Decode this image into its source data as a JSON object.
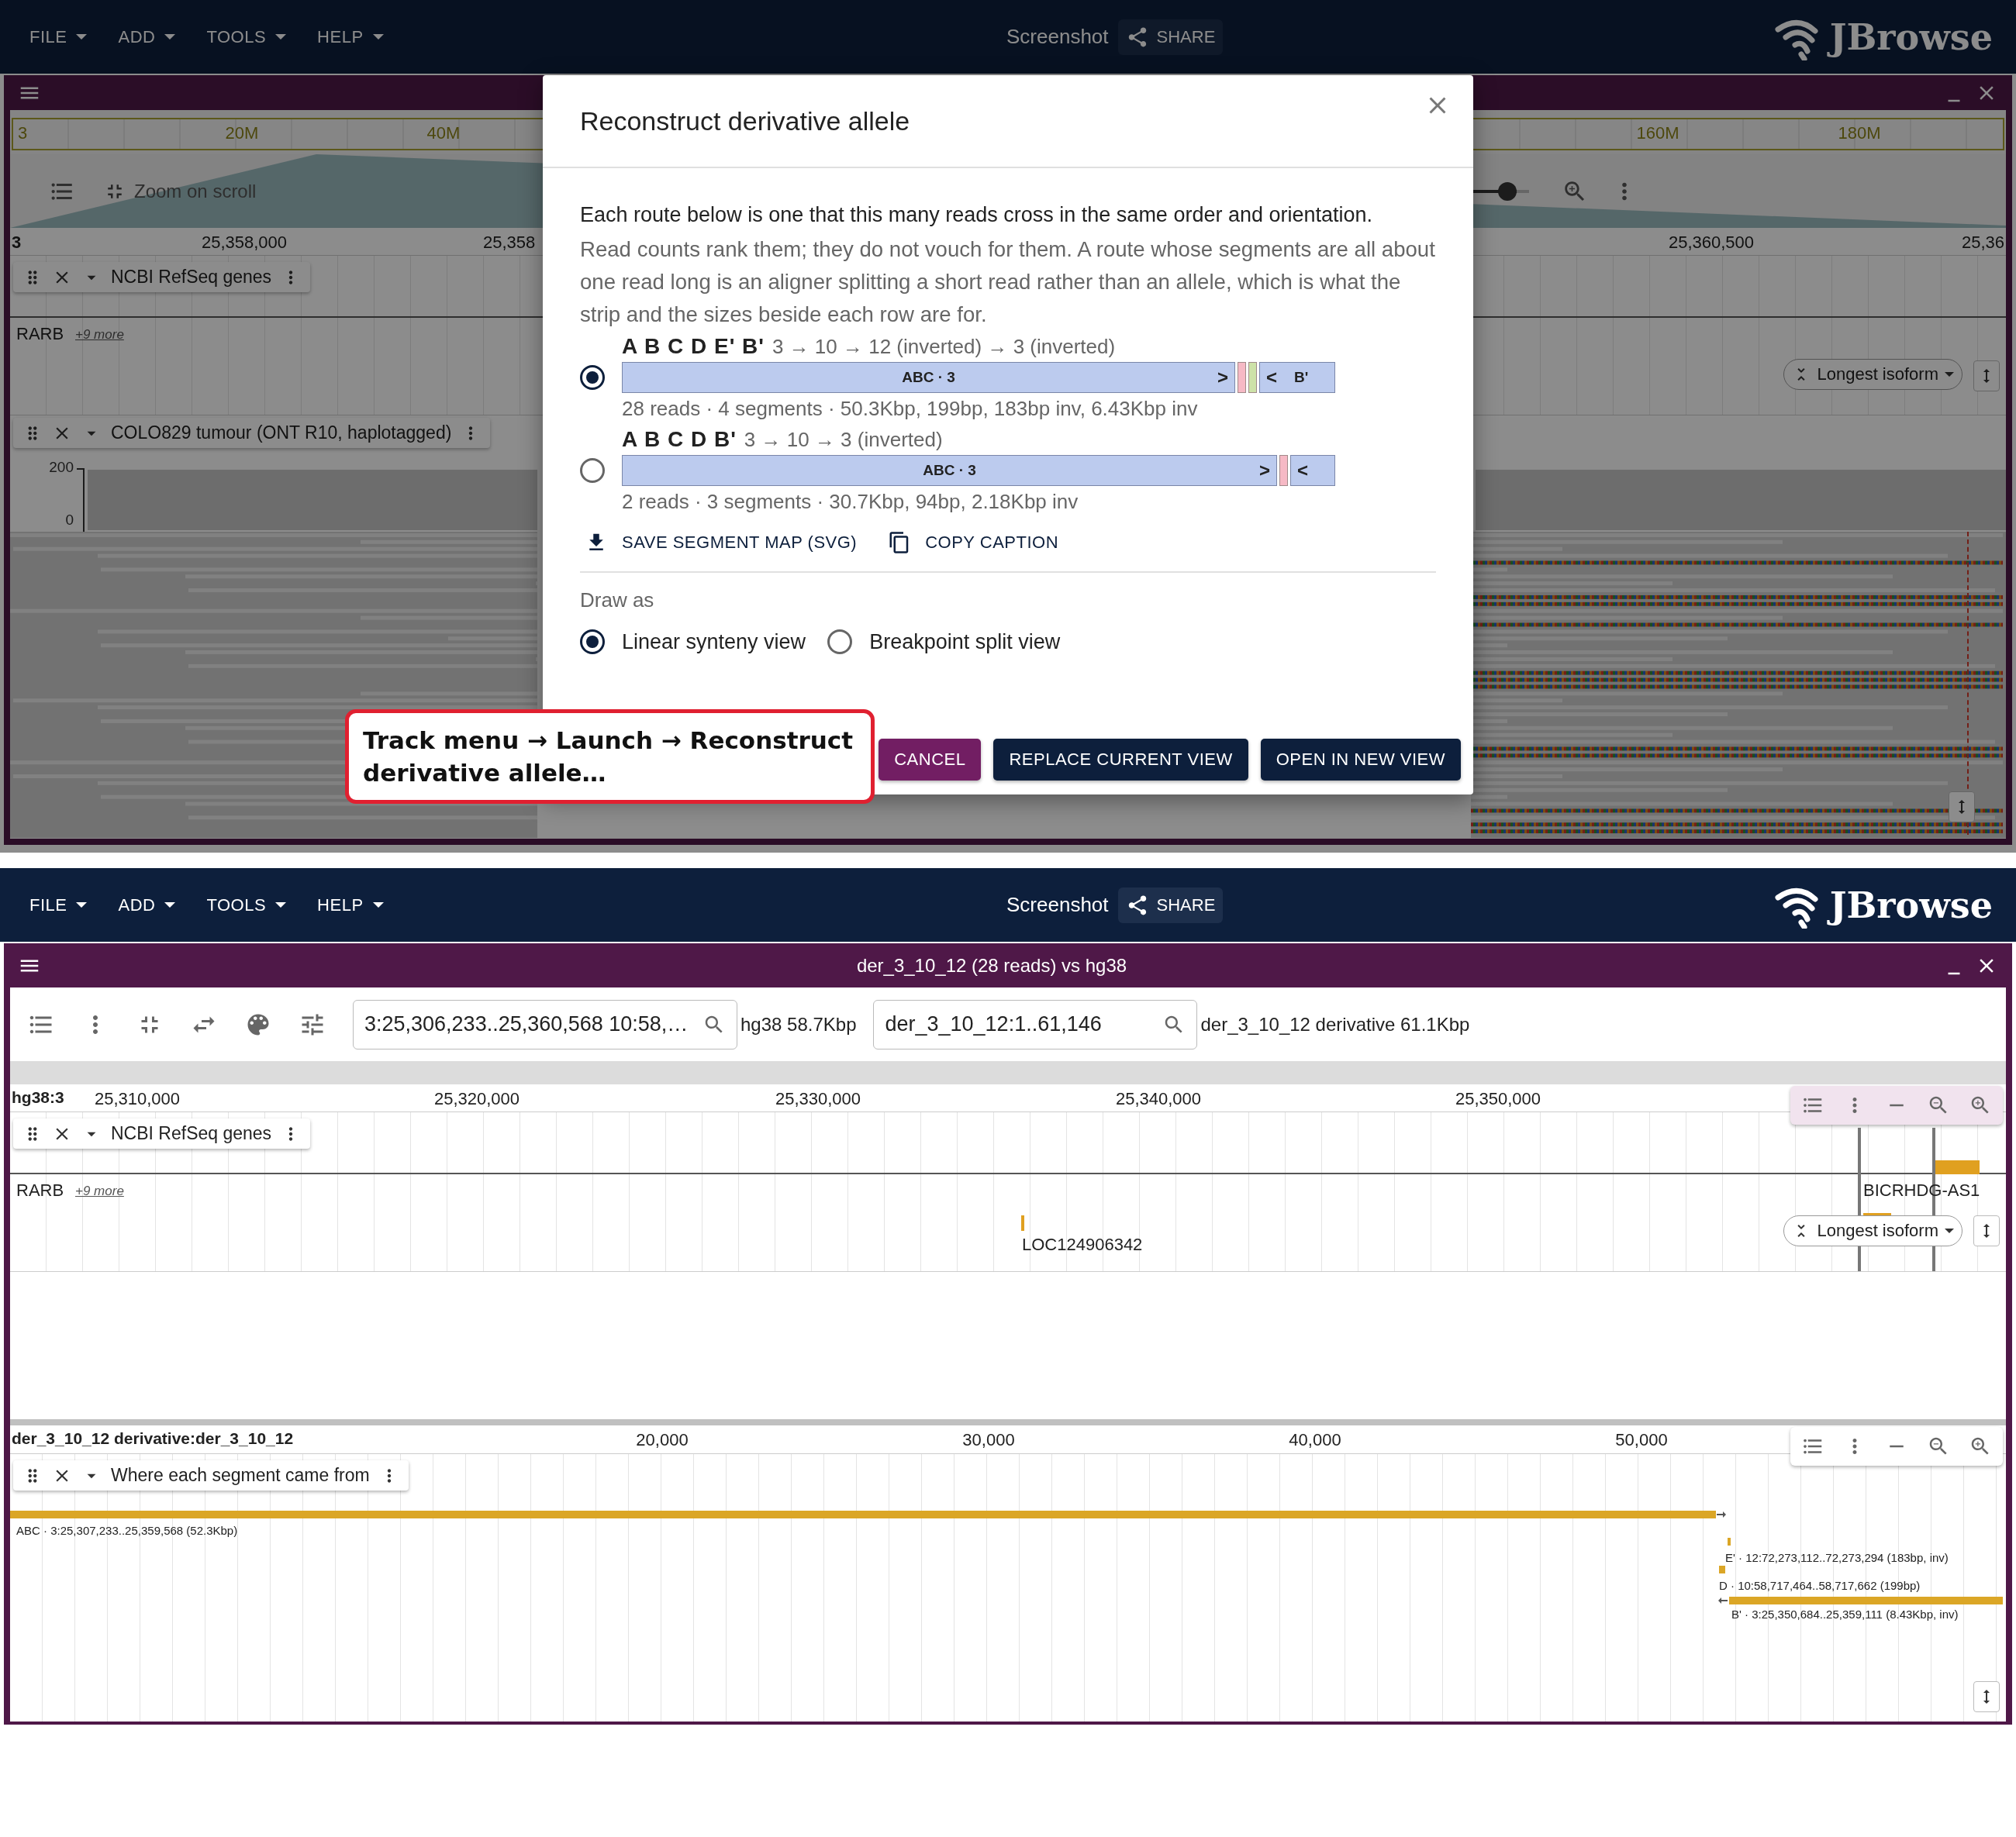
{
  "top": {
    "app_bar": {
      "menus": [
        "FILE",
        "ADD",
        "TOOLS",
        "HELP"
      ],
      "screenshot": "Screenshot",
      "share": "SHARE",
      "logo": "JBrowse"
    },
    "view": {
      "overview_labels": [
        "3",
        "20M",
        "40M",
        "160M",
        "180M"
      ],
      "zoom_toggle": "Zoom on scroll",
      "zoom_slider": {
        "level": 0.7
      },
      "ruler_labels": [
        "3",
        "25,358,000",
        "25,358",
        "25,360,500",
        "25,36"
      ],
      "genes_track": {
        "title": "NCBI RefSeq genes",
        "labels": [
          {
            "kind": "gene",
            "text": "RARB"
          },
          {
            "kind": "more",
            "text": "+9 more"
          }
        ],
        "isoform": "Longest isoform"
      },
      "reads_track": {
        "title": "COLO829 tumour (ONT R10, haplotagged)",
        "axis": [
          "200",
          "0"
        ]
      }
    }
  },
  "dialog": {
    "title": "Reconstruct derivative allele",
    "intro": "Each route below is one that this many reads cross in the same order and orientation.",
    "note": "Read counts rank them; they do not vouch for them. A route whose segments are all about one read long is an aligner splitting a short read rather than an allele, which is what the strip and the sizes beside each row are for.",
    "routes": [
      {
        "name": "A B C D E' B'",
        "path": "3 → 10 → 12 (inverted) → 3 (inverted)",
        "selected": true,
        "segments": [
          {
            "kind": "main",
            "label": "ABC · 3",
            "arrow": ">",
            "color": "#bccbee"
          },
          {
            "kind": "sliver",
            "color": "#f6b9c5"
          },
          {
            "kind": "sliver",
            "color": "#cde2a8"
          },
          {
            "kind": "end",
            "arrow": "<",
            "label": "B'",
            "color": "#bccbee"
          }
        ],
        "stats": "28 reads · 4 segments · 50.3Kbp, 199bp, 183bp inv, 6.43Kbp inv"
      },
      {
        "name": "A B C D B'",
        "path": "3 → 10 → 3 (inverted)",
        "selected": false,
        "segments": [
          {
            "kind": "main",
            "label": "ABC · 3",
            "arrow": ">",
            "color": "#bccbee"
          },
          {
            "kind": "sliver",
            "color": "#f6b9c5"
          },
          {
            "kind": "end",
            "arrow": "<",
            "color": "#bccbee"
          }
        ],
        "stats": "2 reads · 3 segments · 30.7Kbp, 94bp, 2.18Kbp inv"
      }
    ],
    "actions": [
      {
        "kind": "download",
        "label": "SAVE SEGMENT MAP (SVG)"
      },
      {
        "kind": "copy",
        "label": "COPY CAPTION"
      }
    ],
    "draw_as": {
      "label": "Draw as",
      "options": [
        {
          "label": "Linear synteny view",
          "selected": true
        },
        {
          "label": "Breakpoint split view",
          "selected": false
        }
      ]
    },
    "buttons": [
      {
        "kind": "secondary",
        "label": "CANCEL"
      },
      {
        "kind": "primary",
        "label": "REPLACE CURRENT VIEW"
      },
      {
        "kind": "primary",
        "label": "OPEN IN NEW VIEW"
      }
    ]
  },
  "callout": "Track menu → Launch → Reconstruct derivative allele…",
  "bottom": {
    "app_bar": {
      "menus": [
        "FILE",
        "ADD",
        "TOOLS",
        "HELP"
      ],
      "screenshot": "Screenshot",
      "share": "SHARE",
      "logo": "JBrowse"
    },
    "view": {
      "title": "der_3_10_12 (28 reads) vs hg38",
      "locations": [
        {
          "value": "3:25,306,233..25,360,568 10:58,…",
          "caption": "hg38 58.7Kbp"
        },
        {
          "value": "der_3_10_12:1..61,146",
          "caption": "der_3_10_12 derivative 61.1Kbp"
        }
      ],
      "reference": {
        "ruler_name": "hg38:3",
        "ticks": [
          "25,310,000",
          "25,320,000",
          "25,330,000",
          "25,340,000",
          "25,350,000"
        ],
        "track": {
          "title": "NCBI RefSeq genes",
          "labels": [
            {
              "kind": "gene",
              "text": "RARB"
            },
            {
              "kind": "more",
              "text": "+9 more"
            },
            {
              "kind": "gene",
              "text": "LOC124906342"
            },
            {
              "kind": "gene",
              "text": "BICRHDG-AS1"
            }
          ],
          "isoform": "Longest isoform"
        }
      },
      "derivative": {
        "ruler_name": "der_3_10_12 derivative:der_3_10_12",
        "ticks": [
          "20,000",
          "30,000",
          "40,000",
          "50,000"
        ],
        "track": {
          "title": "Where each segment came from",
          "features": [
            {
              "label": "ABC · 3:25,307,233..25,359,568 (52.3Kbp)",
              "kind": "forward"
            },
            {
              "label": "E' · 12:72,273,112..72,273,294 (183bp, inv)"
            },
            {
              "label": "D · 10:58,717,464..58,717,662 (199bp)"
            },
            {
              "label": "B' · 3:25,350,684..25,359,111 (8.43Kbp, inv)",
              "kind": "reverse"
            }
          ]
        }
      }
    }
  }
}
